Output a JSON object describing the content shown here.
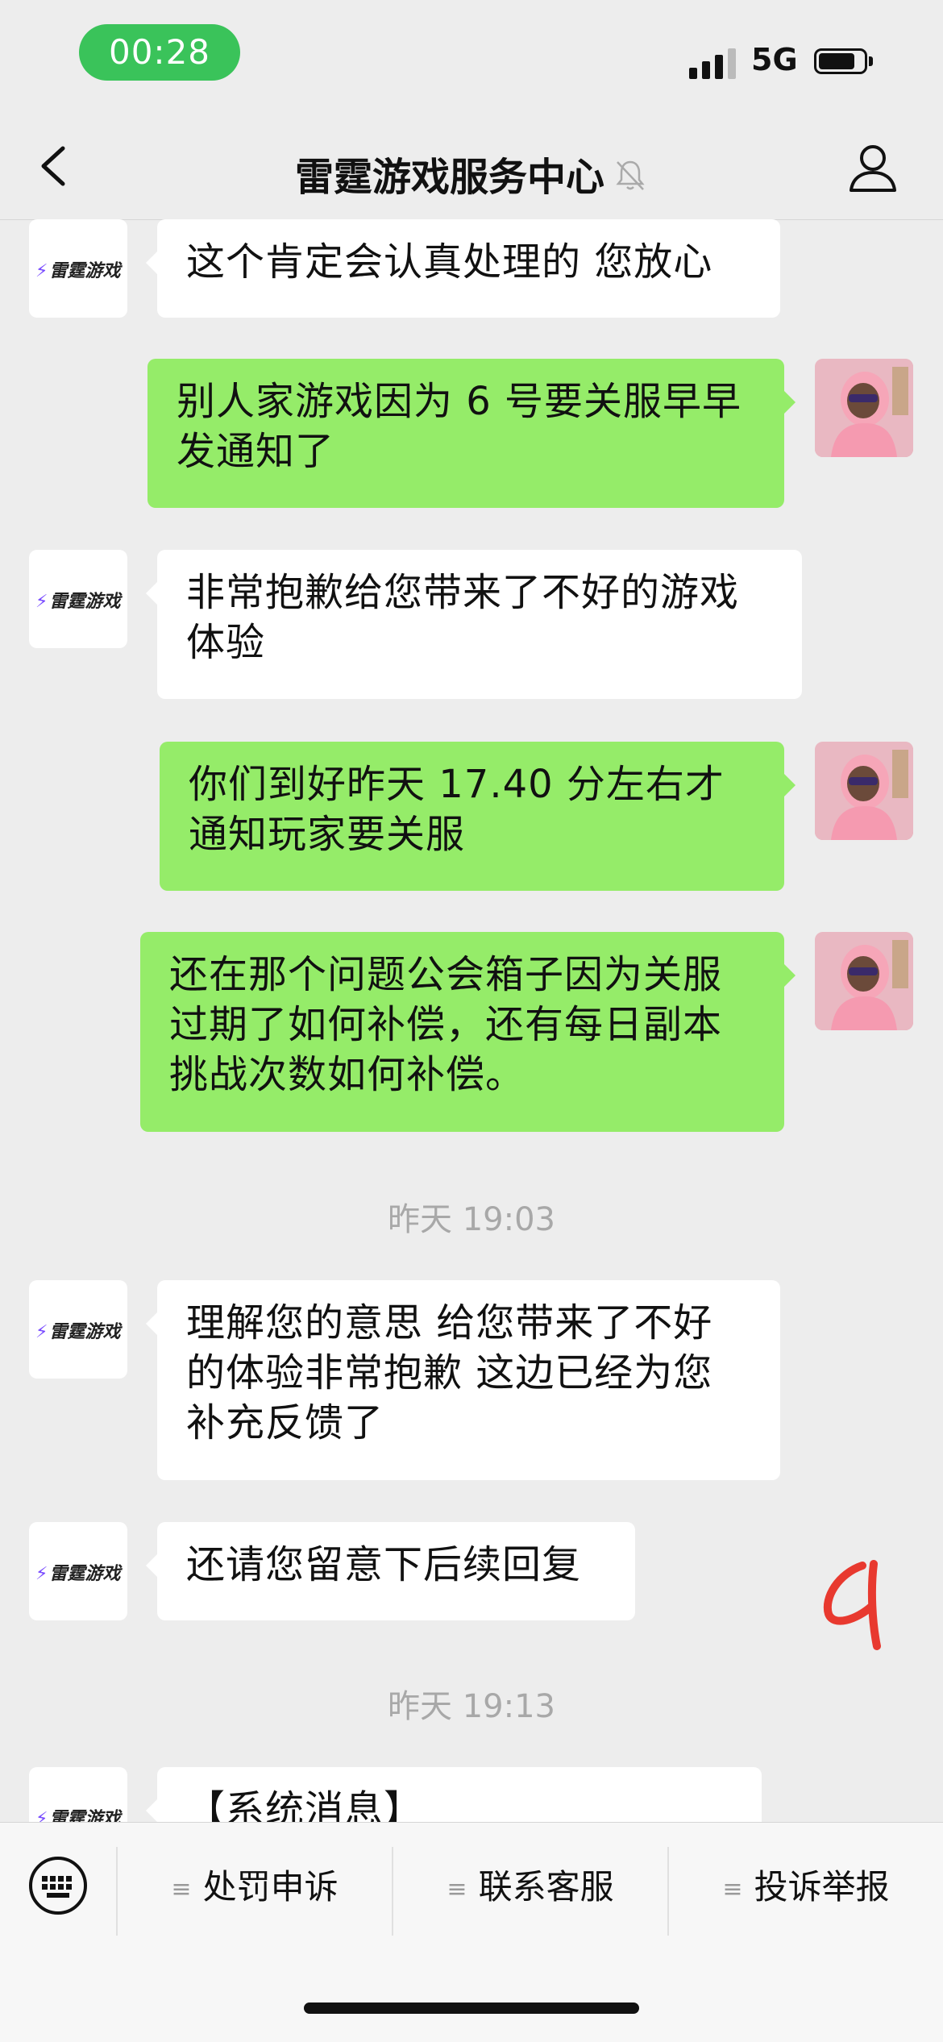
{
  "status_bar": {
    "time": "00:28",
    "network": "5G"
  },
  "nav": {
    "title": "雷霆游戏服务中心"
  },
  "brand_logo": "雷霆游戏",
  "messages": [
    {
      "from": "service",
      "text": "这个肯定会认真处理的  您放心"
    },
    {
      "from": "user",
      "text": "别人家游戏因为 6 号要关服早早发通知了"
    },
    {
      "from": "service",
      "text": "非常抱歉给您带来了不好的游戏体验"
    },
    {
      "from": "user",
      "text": "你们到好昨天 17.40 分左右才通知玩家要关服"
    },
    {
      "from": "user",
      "text": "还在那个问题公会箱子因为关服过期了如何补偿，还有每日副本挑战次数如何补偿。"
    },
    {
      "from": "service",
      "text": "理解您的意思  给您带来了不好的体验非常抱歉  这边已经为您补充反馈了"
    },
    {
      "from": "service",
      "text": "还请您留意下后续回复"
    },
    {
      "from": "service",
      "text": "【系统消息】"
    }
  ],
  "timestamps": [
    "昨天 19:03",
    "昨天 19:13"
  ],
  "bottom_menu": {
    "items": [
      {
        "label": "处罚申诉"
      },
      {
        "label": "联系客服"
      },
      {
        "label": "投诉举报"
      }
    ]
  },
  "colors": {
    "accent": "#3ac35a",
    "outgoing_bubble": "#95ec69",
    "background": "#ededed",
    "handwriting": "#e8392f"
  }
}
